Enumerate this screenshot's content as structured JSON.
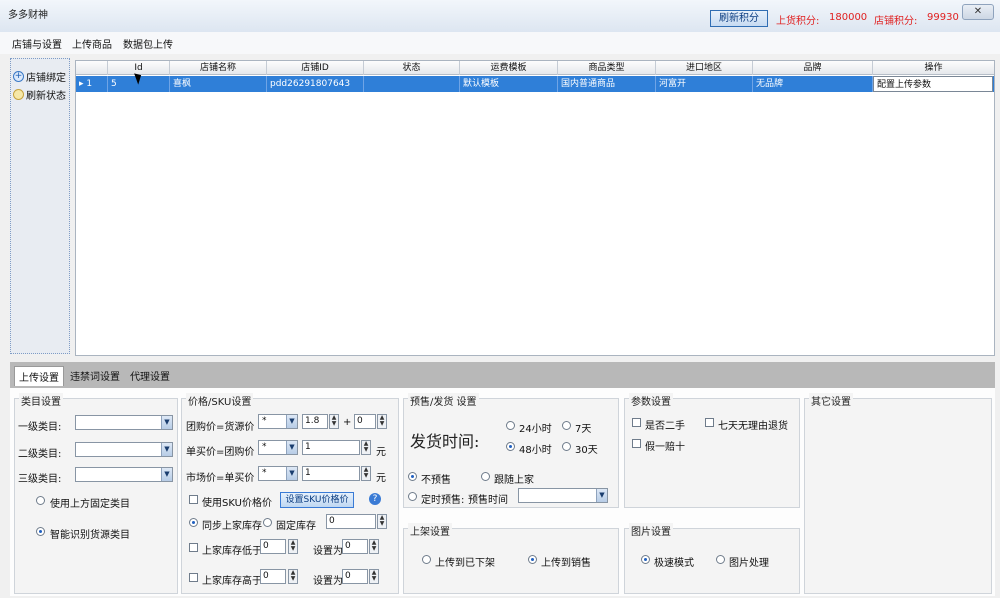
{
  "window": {
    "title": "多多财神",
    "refresh_button": "刷新积分",
    "upload_points_label": "上货积分:",
    "upload_points_value": "180000",
    "store_points_label": "店铺积分:",
    "store_points_value": "99930",
    "close_label": "✕"
  },
  "menu": [
    "店铺与设置",
    "上传商品",
    "数据包上传"
  ],
  "sidebar": [
    "店铺绑定",
    "刷新状态"
  ],
  "grid": {
    "columns": [
      "Id",
      "店铺名称",
      "店铺ID",
      "状态",
      "运费模板",
      "商品类型",
      "进口地区",
      "品牌",
      "操作"
    ],
    "rows": [
      {
        "indicator": "▸ 1",
        "id": "5",
        "store_name": "喜枫",
        "store_id": "pdd26291807643",
        "status": "",
        "shipping_template": "默认模板",
        "product_type": "国内普通商品",
        "import_region": "河富开",
        "brand": "无品牌",
        "action": "配置上传参数"
      }
    ]
  },
  "tabs": [
    "上传设置",
    "违禁词设置",
    "代理设置"
  ],
  "category": {
    "title": "类目设置",
    "level1": "一级类目:",
    "level2": "二级类目:",
    "level3": "三级类目:",
    "option_fixed": "使用上方固定类目",
    "option_smart": "智能识别货源类目"
  },
  "price": {
    "title": "价格/SKU设置",
    "group_label": "团购价=货源价",
    "single_label": "单买价=团购价",
    "market_label": "市场价=单买价",
    "op_mul": "*",
    "group_factor": "1.8",
    "plus": "+",
    "group_add": "0",
    "single_factor": "1",
    "market_factor": "1",
    "unit": "元",
    "use_sku_label": "使用SKU价格价",
    "set_sku_button": "设置SKU价格价",
    "stock_sync": "同步上家库存",
    "stock_fixed": "固定库存",
    "stock_fixed_value": "0",
    "stock_below": "上家库存低于",
    "stock_below_value": "0",
    "set_to": "设置为",
    "set_to_value_1": "0",
    "stock_above": "上家库存高于",
    "stock_above_value": "0",
    "set_to_value_2": "0"
  },
  "presale": {
    "title": "预售/发货 设置",
    "ship_time_label": "发货时间:",
    "opt_24h": "24小时",
    "opt_7d": "7天",
    "opt_48h": "48小时",
    "opt_30d": "30天",
    "no_presale": "不预售",
    "follow_upstream": "跟随上家",
    "timed_presale": "定时预售:",
    "presale_time": "预售时间"
  },
  "params": {
    "title": "参数设置",
    "second_hand": "是否二手",
    "seven_day": "七天无理由退货",
    "fake_one": "假一赔十"
  },
  "other": {
    "title": "其它设置"
  },
  "listing": {
    "title": "上架设置",
    "to_offshelf": "上传到已下架",
    "to_onsale": "上传到销售"
  },
  "image": {
    "title": "图片设置",
    "fast_mode": "极速模式",
    "image_process": "图片处理"
  }
}
